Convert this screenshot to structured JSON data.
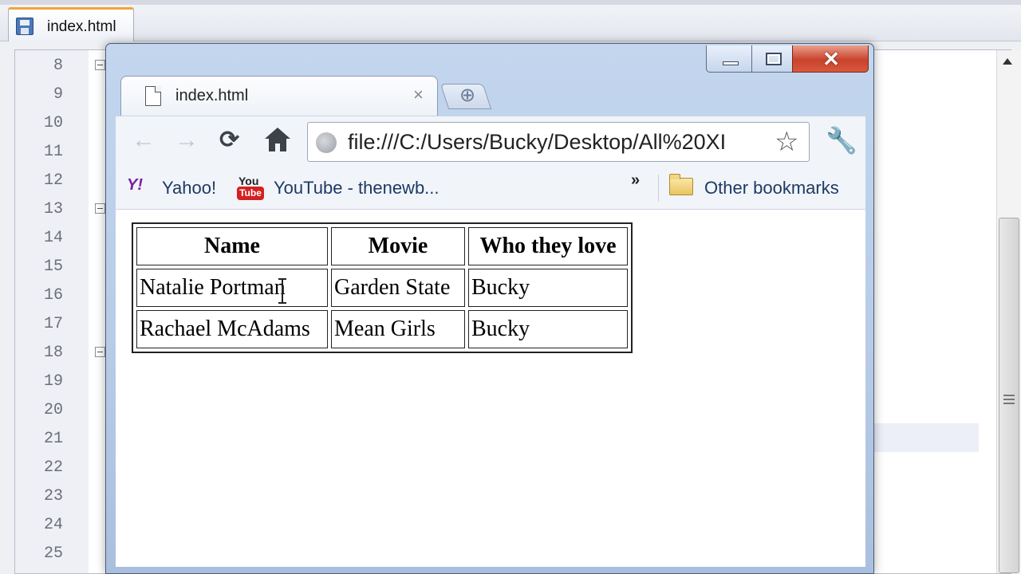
{
  "editor": {
    "tab_label": "index.html",
    "line_numbers": [
      "8",
      "9",
      "10",
      "11",
      "12",
      "13",
      "14",
      "15",
      "16",
      "17",
      "18",
      "19",
      "20",
      "21",
      "22",
      "23",
      "24",
      "25"
    ]
  },
  "browser": {
    "tab": {
      "label": "index.html",
      "close_glyph": "×"
    },
    "new_tab_glyph": "⊕",
    "window_controls": {
      "close_glyph": "✕"
    },
    "toolbar": {
      "back_glyph": "←",
      "forward_glyph": "→",
      "reload_glyph": "⟳",
      "url": "file:///C:/Users/Bucky/Desktop/All%20XI",
      "star_glyph": "☆",
      "wrench_glyph": "🔧"
    },
    "bookmarks": {
      "yahoo_icon": "Y!",
      "yahoo": "Yahoo!",
      "youtube_icon_top": "You",
      "youtube_icon_bottom": "Tube",
      "youtube": "YouTube - thenewb...",
      "overflow_glyph": "»",
      "other": "Other bookmarks"
    },
    "icons": [
      "page-icon",
      "globe-icon",
      "star-icon",
      "wrench-icon",
      "home-icon",
      "folder-icon"
    ]
  },
  "table": {
    "headers": [
      "Name",
      "Movie",
      "Who they love"
    ],
    "rows": [
      [
        "Natalie Portman",
        "Garden State",
        "Bucky"
      ],
      [
        "Rachael McAdams",
        "Mean Girls",
        "Bucky"
      ]
    ]
  },
  "colors": {
    "close_button": "#c9432c",
    "bookmark_text": "#1e3a64",
    "editor_tab_accent": "#f0a53a"
  }
}
